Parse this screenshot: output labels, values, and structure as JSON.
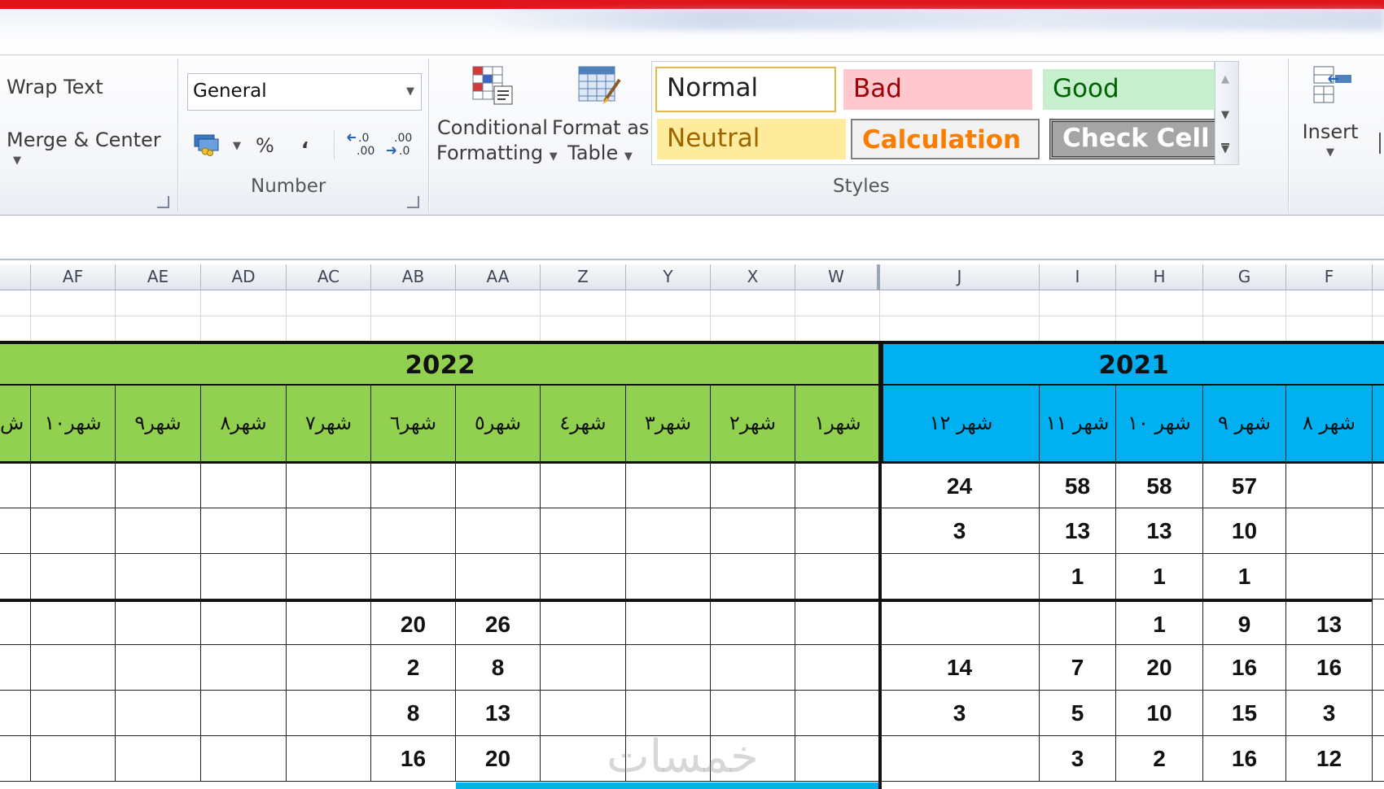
{
  "ribbon": {
    "alignment": {
      "wrap_text": "Wrap Text",
      "merge_center": "Merge & Center"
    },
    "number": {
      "format_value": "General",
      "percent_symbol": "%",
      "comma_symbol": "،",
      "increase_decimal": "←.0 .00",
      "decrease_decimal": ".00 →.0",
      "group_label": "Number"
    },
    "styles": {
      "conditional_formatting": [
        "Conditional",
        "Formatting"
      ],
      "format_as_table": [
        "Format as",
        "Table"
      ],
      "cell_styles": [
        {
          "label": "Normal",
          "bg": "#ffffff",
          "fg": "#000000"
        },
        {
          "label": "Bad",
          "bg": "#ffc7ce",
          "fg": "#9c0006"
        },
        {
          "label": "Good",
          "bg": "#c6efce",
          "fg": "#006100"
        },
        {
          "label": "Neutral",
          "bg": "#ffeb9c",
          "fg": "#9c6500"
        },
        {
          "label": "Calculation",
          "bg": "#f2f2f2",
          "fg": "#fa7d00"
        },
        {
          "label": "Check Cell",
          "bg": "#a5a5a5",
          "fg": "#ffffff"
        }
      ],
      "group_label": "Styles"
    },
    "cells": {
      "insert": "Insert"
    }
  },
  "columns": [
    "AF",
    "AE",
    "AD",
    "AC",
    "AB",
    "AA",
    "Z",
    "Y",
    "X",
    "W",
    "J",
    "I",
    "H",
    "G",
    "F"
  ],
  "sheet": {
    "year_2022": "2022",
    "year_2021": "2021",
    "colors": {
      "green": "#92d050",
      "blue": "#00b0f0"
    },
    "months_2022": [
      "شهر١٠",
      "شهر٩",
      "شهر٨",
      "شهر٧",
      "شهر٦",
      "شهر٥",
      "شهر٤",
      "شهر٣",
      "شهر٢",
      "شهر١"
    ],
    "months_2021": [
      "شهر ١٢",
      "شهر ١١",
      "شهر ١٠",
      "شهر ٩",
      "شهر ٨"
    ],
    "rows": [
      [
        "",
        "",
        "",
        "",
        "",
        "",
        "",
        "",
        "",
        "",
        "24",
        "58",
        "58",
        "57",
        ""
      ],
      [
        "",
        "",
        "",
        "",
        "",
        "",
        "",
        "",
        "",
        "",
        "3",
        "13",
        "13",
        "10",
        ""
      ],
      [
        "",
        "",
        "",
        "",
        "",
        "",
        "",
        "",
        "",
        "",
        "",
        "1",
        "1",
        "1",
        ""
      ],
      [
        "",
        "",
        "",
        "",
        "20",
        "26",
        "",
        "",
        "",
        "",
        "",
        "",
        "1",
        "9",
        "13"
      ],
      [
        "",
        "",
        "",
        "",
        "2",
        "8",
        "",
        "",
        "",
        "",
        "14",
        "7",
        "20",
        "16",
        "16"
      ],
      [
        "",
        "",
        "",
        "",
        "8",
        "13",
        "",
        "",
        "",
        "",
        "3",
        "5",
        "10",
        "15",
        "3"
      ],
      [
        "",
        "",
        "",
        "",
        "16",
        "20",
        "",
        "",
        "",
        "",
        "",
        "3",
        "2",
        "16",
        "12"
      ]
    ]
  },
  "watermark": "خمسات"
}
